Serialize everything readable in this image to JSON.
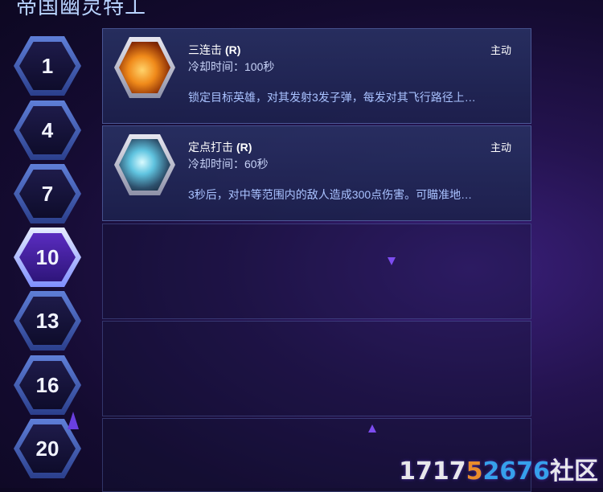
{
  "header": {
    "title": "帝国幽灵特工"
  },
  "levels": [
    {
      "label": "1",
      "active": false
    },
    {
      "label": "4",
      "active": false
    },
    {
      "label": "7",
      "active": false
    },
    {
      "label": "10",
      "active": true
    },
    {
      "label": "13",
      "active": false
    },
    {
      "label": "16",
      "active": false
    },
    {
      "label": "20",
      "active": false
    }
  ],
  "abilities": [
    {
      "name": "三连击",
      "hotkey": "(R)",
      "type": "主动",
      "cooldown": "冷却时间：100秒",
      "description": "锁定目标英雄，对其发射3发子弹，每发对其飞行路径上…",
      "icon": "triple-shot-icon"
    },
    {
      "name": "定点打击",
      "hotkey": "(R)",
      "type": "主动",
      "cooldown": "冷却时间：60秒",
      "description": "3秒后，对中等范围内的敌人造成300点伤害。可瞄准地…",
      "icon": "precision-strike-icon"
    }
  ],
  "watermark": {
    "part1": "1717",
    "part2": "5",
    "part3": "2676",
    "part4": "社区"
  },
  "colors": {
    "accent": "#5f7fd8",
    "active_level": "#5a2cc0",
    "background": "#24134f"
  }
}
